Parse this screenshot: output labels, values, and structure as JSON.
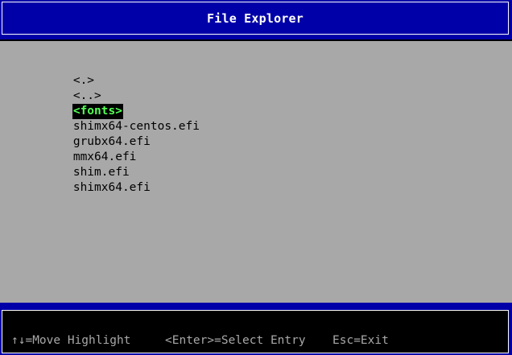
{
  "window": {
    "title": "File Explorer"
  },
  "files": [
    {
      "label": "<.>",
      "highlighted": false
    },
    {
      "label": "<..>",
      "highlighted": false
    },
    {
      "label": "<fonts>",
      "highlighted": true
    },
    {
      "label": "shimx64-centos.efi",
      "highlighted": false
    },
    {
      "label": "grubx64.efi",
      "highlighted": false
    },
    {
      "label": "mmx64.efi",
      "highlighted": false
    },
    {
      "label": "shim.efi",
      "highlighted": false
    },
    {
      "label": "shimx64.efi",
      "highlighted": false
    }
  ],
  "status": {
    "move": "↑↓=Move Highlight",
    "select": "<Enter>=Select Entry",
    "exit": "Esc=Exit"
  },
  "colors": {
    "title_bg": "#0000a8",
    "panel_bg": "#a8a8a8",
    "highlight_bg": "#000000",
    "highlight_fg": "#55ff55",
    "hint_fg": "#a8a8a8"
  }
}
